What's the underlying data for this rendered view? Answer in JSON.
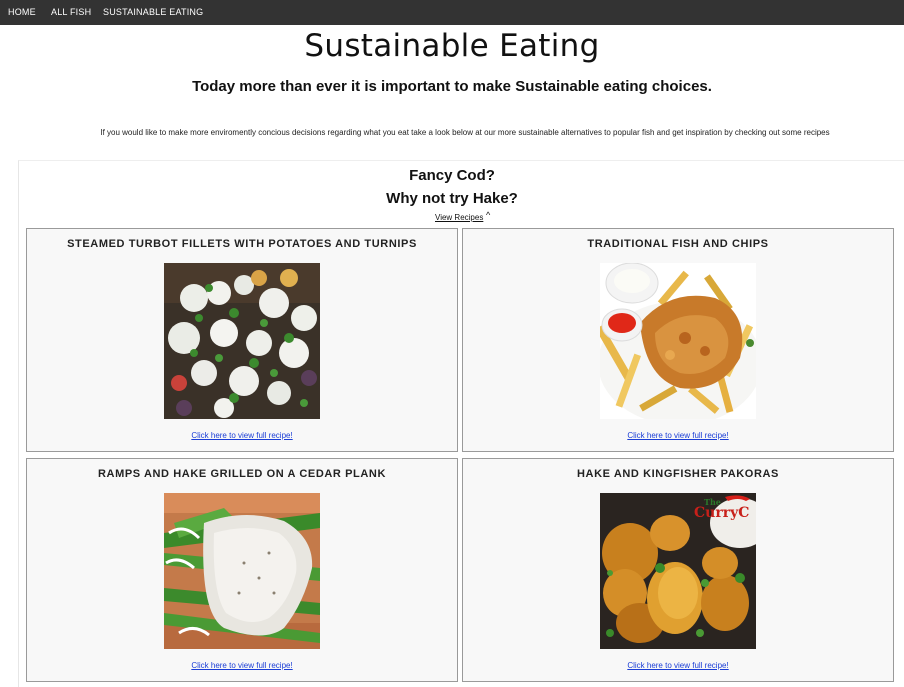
{
  "nav": {
    "items": [
      {
        "label": "HOME"
      },
      {
        "label": "ALL FISH"
      },
      {
        "label": "SUSTAINABLE EATING"
      }
    ]
  },
  "page": {
    "title": "Sustainable Eating",
    "subtitle": "Today more than ever it is important to make Sustainable eating choices.",
    "intro": "If you would like to make more enviromently concious decisions regarding what you eat take a look below at our more sustainable alternatives to popular fish and get inspiration by checking out some recipes"
  },
  "section": {
    "fancy": "Fancy Cod?",
    "why_not": "Why not try Hake?",
    "view_recipes": "View Recipes",
    "caret": "^"
  },
  "recipes": [
    {
      "title": "STEAMED TURBOT FILLETS WITH POTATOES AND TURNIPS",
      "link": "Click here to view full recipe!"
    },
    {
      "title": "TRADITIONAL FISH AND CHIPS",
      "link": "Click here to view full recipe!"
    },
    {
      "title": "RAMPS AND HAKE GRILLED ON A CEDAR PLANK",
      "link": "Click here to view full recipe!"
    },
    {
      "title": "HAKE AND KINGFISHER PAKORAS",
      "link": "Click here to view full recipe!",
      "logo_text": "The CurryC"
    }
  ],
  "colors": {
    "navbar": "#333333",
    "link": "#1a3dd6",
    "card_bg": "#f8f8f8"
  }
}
